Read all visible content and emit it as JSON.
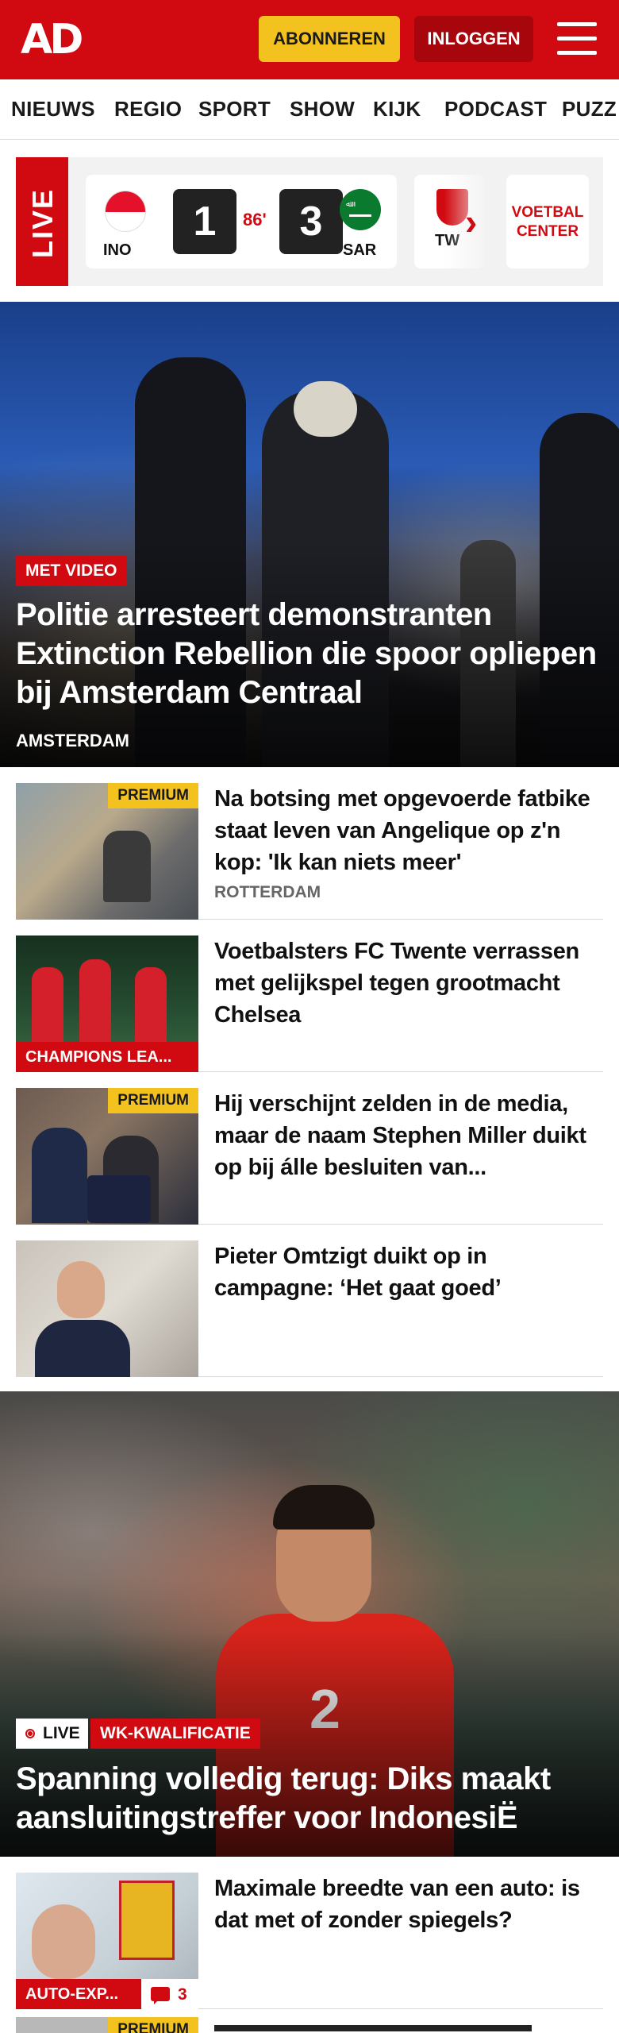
{
  "header": {
    "logo": "AD",
    "subscribe_label": "ABONNEREN",
    "login_label": "INLOGGEN",
    "menu_icon": "hamburger-menu-icon",
    "brand_color": "#d10a11",
    "accent_color": "#f3c21f"
  },
  "nav": {
    "items": [
      "NIEUWS",
      "REGIO",
      "SPORT",
      "SHOW",
      "KIJK",
      "PODCAST",
      "PUZZ"
    ]
  },
  "livebar": {
    "label": "LIVE",
    "match": {
      "home_code": "INO",
      "home_score": "1",
      "minute": "86'",
      "away_score": "3",
      "away_code": "SAR"
    },
    "next_match_code": "TW",
    "arrow_icon": "chevron-right-icon",
    "voetbal_center": "VOETBAL CENTER"
  },
  "hero": {
    "tag": "MET VIDEO",
    "title": "Politie arresteert demonstranten Extinction Rebellion die spoor opliepen bij Amsterdam Centraal",
    "location": "AMSTERDAM"
  },
  "articles": [
    {
      "premium": "PREMIUM",
      "title": "Na botsing met opgevoerde fatbike staat leven van Angelique op z'n kop: 'Ik kan niets meer'",
      "location": "ROTTERDAM"
    },
    {
      "category": "CHAMPIONS LEA...",
      "title": "Voetbalsters FC Twente verrassen met gelijkspel tegen grootmacht Chelsea"
    },
    {
      "premium": "PREMIUM",
      "title": "Hij verschijnt zelden in de media, maar de naam Stephen Miller duikt op bij álle besluiten van..."
    },
    {
      "title": "Pieter Omtzigt duikt op in campagne: ‘Het gaat goed’"
    }
  ],
  "hero2": {
    "live_label": "LIVE",
    "category": "WK-KWALIFICATIE",
    "title": "Spanning volledig terug: Diks maakt aansluitingstreffer voor IndonesiË",
    "shirt_number": "2"
  },
  "article5": {
    "category": "AUTO-EXP...",
    "comments": "3",
    "title": "Maximale breedte van een auto: is dat met of zonder spiegels?"
  },
  "article6": {
    "premium": "PREMIUM"
  }
}
